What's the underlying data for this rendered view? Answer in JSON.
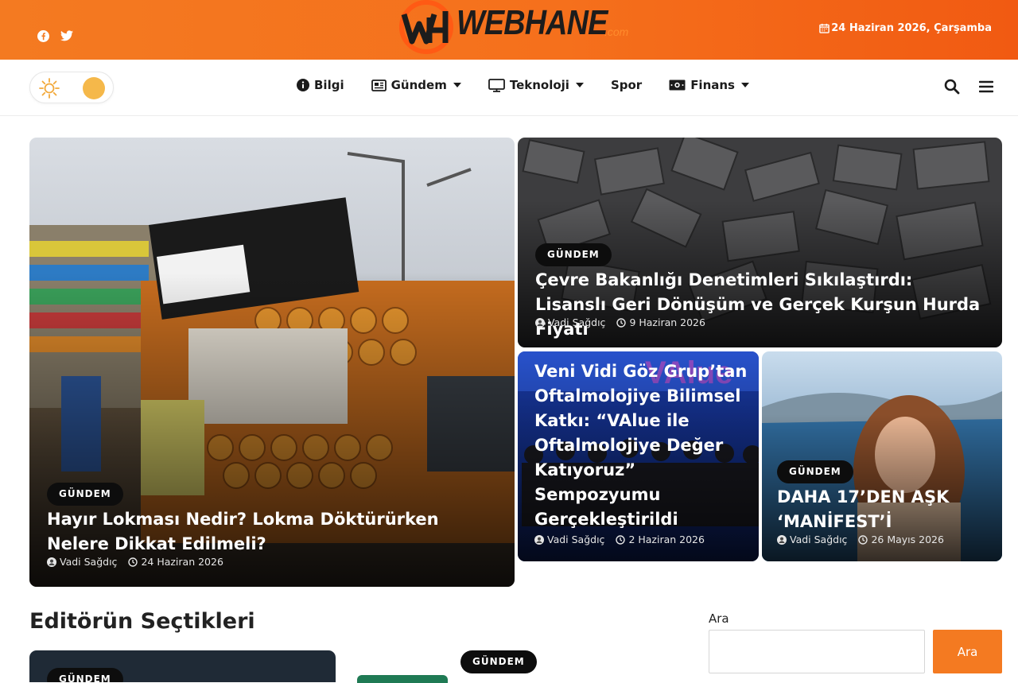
{
  "header": {
    "logo": {
      "word": "WEBHANE",
      "tld": ".com"
    },
    "date": "24 Haziran 2026, Çarşamba",
    "social": [
      "facebook-icon",
      "twitter-icon"
    ]
  },
  "nav": {
    "items": [
      {
        "label": "Bilgi",
        "icon": "info-icon",
        "dropdown": false
      },
      {
        "label": "Gündem",
        "icon": "newspaper-icon",
        "dropdown": true
      },
      {
        "label": "Teknoloji",
        "icon": "monitor-icon",
        "dropdown": true
      },
      {
        "label": "Spor",
        "icon": "",
        "dropdown": false
      },
      {
        "label": "Finans",
        "icon": "money-icon",
        "dropdown": true
      }
    ]
  },
  "featured": [
    {
      "category": "GÜNDEM",
      "title": "Hayır Lokması Nedir? Lokma Döktürürken Nelere Dikkat Edilmeli?",
      "author": "Vadi Sağdıç",
      "date": "24 Haziran 2026"
    },
    {
      "category": "GÜNDEM",
      "title": "Çevre Bakanlığı Denetimleri Sıkılaştırdı: Lisanslı Geri Dönüşüm ve Gerçek Kurşun Hurda Fiyatı",
      "author": "Vadi Sağdıç",
      "date": "9 Haziran 2026"
    },
    {
      "category": "GÜNDEM",
      "title": "Veni Vidi Göz Grup’tan Oftalmolojiye Bilimsel Katkı: “VAlue ile Oftalmolojiye Değer Katıyoruz” Sempozyumu Gerçekleştirildi",
      "author": "Vadi Sağdıç",
      "date": "2 Haziran 2026"
    },
    {
      "category": "GÜNDEM",
      "title": "DAHA 17’DEN AŞK ‘MANİFEST’İ",
      "author": "Vadi Sağdıç",
      "date": "26 Mayıs 2026"
    }
  ],
  "editors": {
    "title": "Editörün Seçtikleri",
    "cards": [
      {
        "category": "GÜNDEM"
      },
      {
        "category": "GÜNDEM"
      }
    ]
  },
  "search": {
    "label": "Ara",
    "placeholder": "",
    "button": "Ara"
  },
  "colors": {
    "accent": "#f47a21",
    "badge": "#0d0d0d"
  }
}
